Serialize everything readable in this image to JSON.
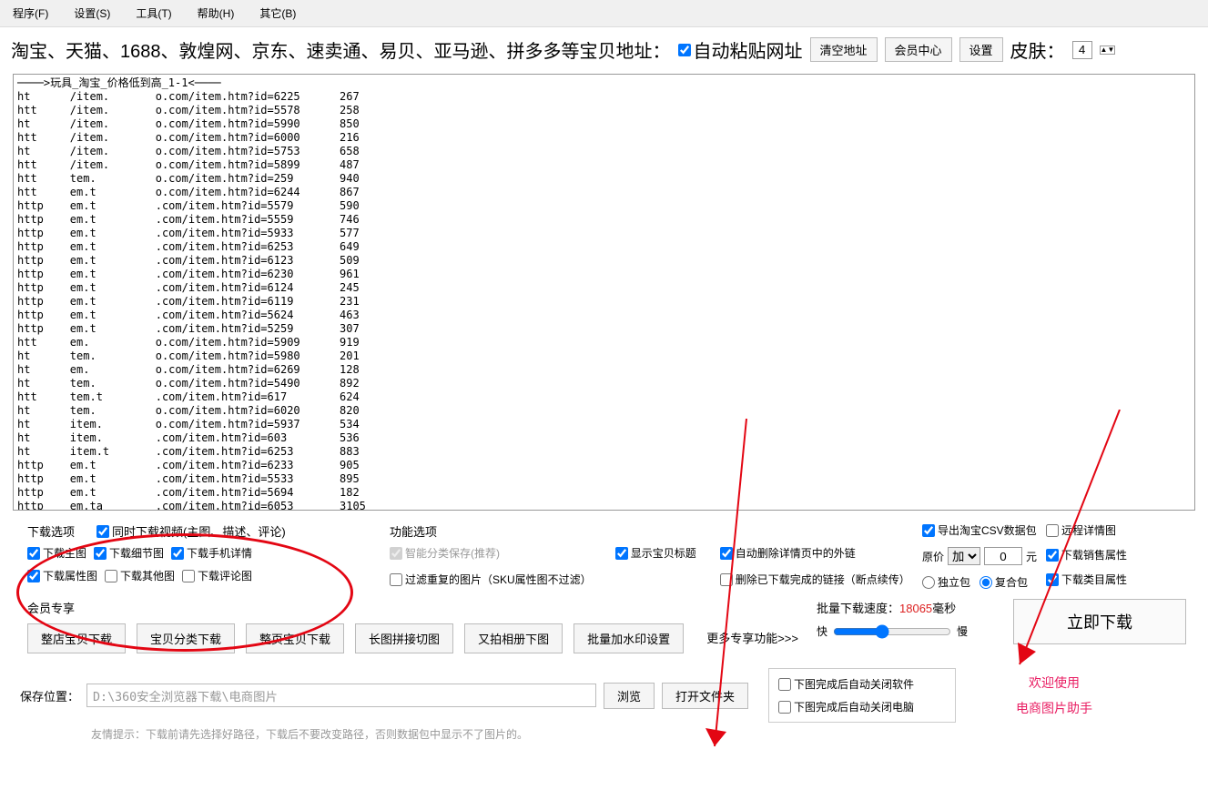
{
  "menubar": [
    "程序(F)",
    "设置(S)",
    "工具(T)",
    "帮助(H)",
    "其它(B)"
  ],
  "addr_label": "淘宝、天猫、1688、敦煌网、京东、速卖通、易贝、亚马逊、拼多多等宝贝地址：",
  "auto_paste": "自动粘贴网址",
  "clear_addr": "清空地址",
  "member_center": "会员中心",
  "settings": "设置",
  "skin_label": "皮肤：",
  "skin_value": "4",
  "urls_text": "────>玩具_淘宝_价格低到高_1-1<────\nht      /item.       o.com/item.htm?id=6225      267\nhtt     /item.       o.com/item.htm?id=5578      258\nht      /item.       o.com/item.htm?id=5990      850\nhtt     /item.       o.com/item.htm?id=6000      216\nht      /item.       o.com/item.htm?id=5753      658\nhtt     /item.       o.com/item.htm?id=5899      487\nhtt     tem.         o.com/item.htm?id=259       940\nhtt     em.t         o.com/item.htm?id=6244      867\nhttp    em.t         .com/item.htm?id=5579       590\nhttp    em.t         .com/item.htm?id=5559       746\nhttp    em.t         .com/item.htm?id=5933       577\nhttp    em.t         .com/item.htm?id=6253       649\nhttp    em.t         .com/item.htm?id=6123       509\nhttp    em.t         .com/item.htm?id=6230       961\nhttp    em.t         .com/item.htm?id=6124       245\nhttp    em.t         .com/item.htm?id=6119       231\nhttp    em.t         .com/item.htm?id=5624       463\nhttp    em.t         .com/item.htm?id=5259       307\nhtt     em.          o.com/item.htm?id=5909      919\nht      tem.         o.com/item.htm?id=5980      201\nht      em.          o.com/item.htm?id=6269      128\nht      tem.         o.com/item.htm?id=5490      892\nhtt     tem.t        .com/item.htm?id=617        624\nht      tem.         o.com/item.htm?id=6020      820\nht      item.        o.com/item.htm?id=5937      534\nht      item.        .com/item.htm?id=603        536\nht      item.t       .com/item.htm?id=6253       883\nhttp    em.t         .com/item.htm?id=6233       905\nhttp    em.t         .com/item.htm?id=5533       895\nhttp    em.t         .com/item.htm?id=5694       182\nhttp    em.ta        .com/item.htm?id=6053       3105",
  "dl_options_title": "下载选项",
  "opt_video": "同时下载视频(主图、描述、评论)",
  "opt_main": "下载主图",
  "opt_detail": "下载细节图",
  "opt_mobile": "下载手机详情",
  "opt_attr": "下载属性图",
  "opt_other": "下载其他图",
  "opt_comment": "下载评论图",
  "func_title": "功能选项",
  "func_smart": "智能分类保存(推荐)",
  "func_title_show": "显示宝贝标题",
  "func_autodel": "自动删除详情页中的外链",
  "func_filter": "过滤重复的图片（SKU属性图不过滤）",
  "func_deldone": "删除已下载完成的链接（断点续传）",
  "csv_export": "导出淘宝CSV数据包",
  "remote_detail": "远程详情图",
  "orig_price": "原价",
  "price_op": "加",
  "price_val": "0",
  "price_unit": "元",
  "sale_attr": "下载销售属性",
  "indep_pack": "独立包",
  "compound_pack": "复合包",
  "cat_attr": "下载类目属性",
  "member_title": "会员专享",
  "btn_whole_shop": "整店宝贝下载",
  "btn_classify": "宝贝分类下载",
  "btn_whole_page": "整页宝贝下载",
  "btn_long_img": "长图拼接切图",
  "btn_album": "又拍相册下图",
  "btn_watermark": "批量加水印设置",
  "more_func": "更多专享功能>>>",
  "speed_title_a": "批量下载速度：",
  "speed_val": "18065",
  "speed_unit": "毫秒",
  "fast": "快",
  "slow": "慢",
  "big_download": "立即下载",
  "save_loc_label": "保存位置：",
  "save_path": "D:\\360安全浏览器下载\\电商图片",
  "browse": "浏览",
  "open_folder": "打开文件夹",
  "auto_close_soft": "下图完成后自动关闭软件",
  "auto_close_pc": "下图完成后自动关闭电脑",
  "welcome1": "欢迎使用",
  "welcome2": "电商图片助手",
  "hint": "友情提示：下载前请先选择好路径，下载后不要改变路径，否则数据包中显示不了图片的。"
}
